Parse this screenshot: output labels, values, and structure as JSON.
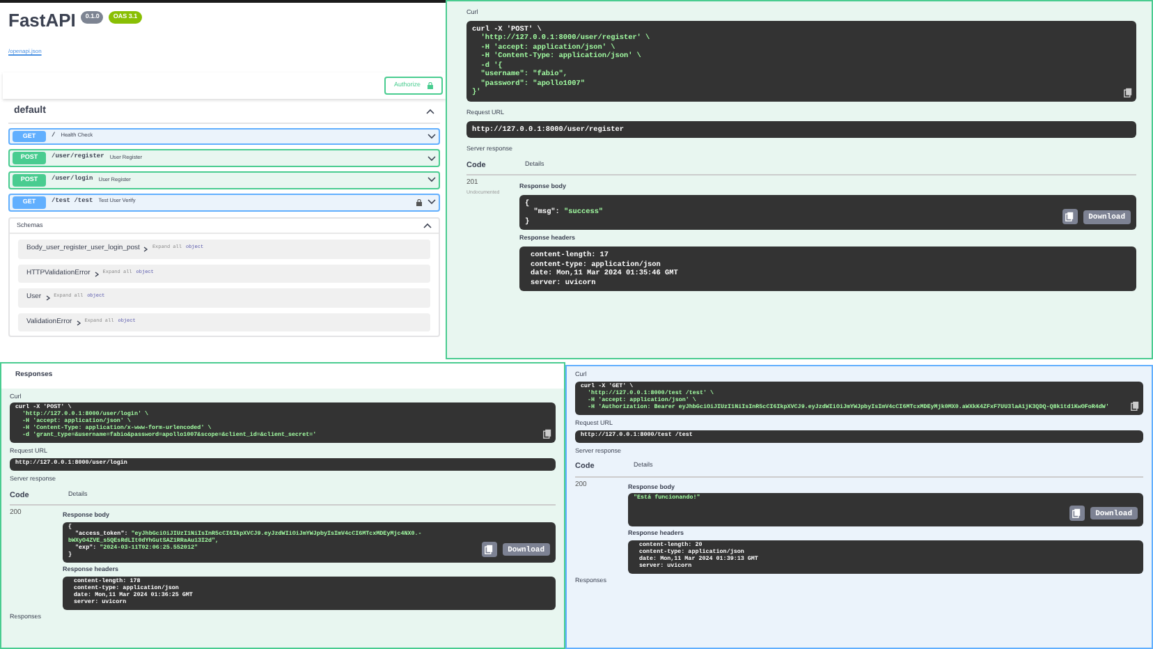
{
  "overview": {
    "title": "FastAPI",
    "version_badge": "0.1.0",
    "oas_badge": "OAS 3.1",
    "spec_link": "/openapi.json",
    "authorize_button": "Authorize",
    "tag": {
      "name": "default",
      "expanded": true
    },
    "operations": [
      {
        "kind": "get",
        "method": "GET",
        "path": "/",
        "summary": "Health Check",
        "locked": false
      },
      {
        "kind": "post",
        "method": "POST",
        "path": "/user/register",
        "summary": "User Register",
        "locked": false
      },
      {
        "kind": "post",
        "method": "POST",
        "path": "/user/login",
        "summary": "User Register",
        "locked": false
      },
      {
        "kind": "get",
        "method": "GET",
        "path": "/test /test",
        "summary": "Test User Verify",
        "locked": true
      }
    ],
    "schemas": {
      "title": "Schemas",
      "expanded": true,
      "items": [
        {
          "name": "Body_user_register_user_login_post",
          "hint": "Expand all",
          "type": "object"
        },
        {
          "name": "HTTPValidationError",
          "hint": "Expand all",
          "type": "object"
        },
        {
          "name": "User",
          "hint": "Expand all",
          "type": "object"
        },
        {
          "name": "ValidationError",
          "hint": "Expand all",
          "type": "object"
        }
      ]
    }
  },
  "register_response": {
    "kind": "post",
    "curl_label": "Curl",
    "curl_lines": [
      {
        "key": "curl -X 'POST' \\"
      },
      {
        "value": "  'http://127.0.0.1:8000/user/register' \\"
      },
      {
        "value": "  -H 'accept: application/json' \\"
      },
      {
        "value": "  -H 'Content-Type: application/json' \\"
      },
      {
        "value": "  -d '{"
      },
      {
        "value": "  \"username\": \"fabio\","
      },
      {
        "value": "  \"password\": \"apollo1007\""
      },
      {
        "value": "}'"
      }
    ],
    "request_url_label": "Request URL",
    "request_url": "http://127.0.0.1:8000/user/register",
    "server_response_label": "Server response",
    "code_header": "Code",
    "details_header": "Details",
    "code": "201",
    "code_note": "Undocumented",
    "body_label": "Response body",
    "body_lines": [
      {
        "key": "{"
      },
      {
        "key": "  \"msg\": ",
        "value": "\"success\""
      },
      {
        "key": "}"
      }
    ],
    "download_button": "Download",
    "headers_label": "Response headers",
    "header_lines": [
      "content-length: 17",
      "content-type: application/json",
      "date: Mon,11 Mar 2024 01:35:46 GMT",
      "server: uvicorn"
    ]
  },
  "login_response": {
    "kind": "post",
    "section_title": "Responses",
    "curl_label": "Curl",
    "curl_lines": [
      {
        "key": "curl -X 'POST' \\"
      },
      {
        "value": "  'http://127.0.0.1:8000/user/login' \\"
      },
      {
        "value": "  -H 'accept: application/json' \\"
      },
      {
        "value": "  -H 'Content-Type: application/x-www-form-urlencoded' \\"
      },
      {
        "value": "  -d 'grant_type=&username=fabio&password=apollo1007&scope=&client_id=&client_secret='"
      }
    ],
    "request_url_label": "Request URL",
    "request_url": "http://127.0.0.1:8000/user/login",
    "server_response_label": "Server response",
    "code_header": "Code",
    "details_header": "Details",
    "code": "200",
    "body_label": "Response body",
    "body_lines": [
      {
        "key": "{"
      },
      {
        "key": "  \"access_token\": ",
        "value": "\"eyJhbGciOiJIUzI1NiIsInR5cCI6IkpXVCJ9.eyJzdWIiOiJmYWJpbyIsImV4cCI6MTcxMDEyMjc4NX0.-bWXyO4ZVE_s5QEsRdLIt0dYhGutSAZ1RRaAu13I2d\","
      },
      {
        "key": "  \"exp\": ",
        "value": "\"2024-03-11T02:06:25.552012\""
      },
      {
        "key": "}"
      }
    ],
    "download_button": "Download",
    "headers_label": "Response headers",
    "header_lines": [
      "content-length: 178",
      "content-type: application/json",
      "date: Mon,11 Mar 2024 01:36:25 GMT",
      "server: uvicorn"
    ],
    "footer": "Responses"
  },
  "test_response": {
    "kind": "get",
    "curl_label": "Curl",
    "curl_lines": [
      {
        "key": "curl -X 'GET' \\"
      },
      {
        "value": "  'http://127.0.0.1:8000/test /test' \\"
      },
      {
        "value": "  -H 'accept: application/json' \\"
      },
      {
        "value": "  -H 'Authorization: Bearer eyJhbGciOiJIUzI1NiIsInR5cCI6IkpXVCJ9.eyJzdWIiOiJmYWJpbyIsImV4cCI6MTcxMDEyMjk0MX0.aWXkK4ZFxF7UU3laA1jK3QDQ-Q8k1td1KwOFoR4dW'"
      }
    ],
    "request_url_label": "Request URL",
    "request_url": "http://127.0.0.1:8000/test /test",
    "server_response_label": "Server response",
    "code_header": "Code",
    "details_header": "Details",
    "code": "200",
    "body_label": "Response body",
    "body_lines": [
      {
        "value": "\"Está funcionando!\""
      }
    ],
    "download_button": "Download",
    "headers_label": "Response headers",
    "header_lines": [
      "content-length: 20",
      "content-type: application/json",
      "date: Mon,11 Mar 2024 01:39:13 GMT",
      "server: uvicorn"
    ],
    "footer": "Responses"
  }
}
